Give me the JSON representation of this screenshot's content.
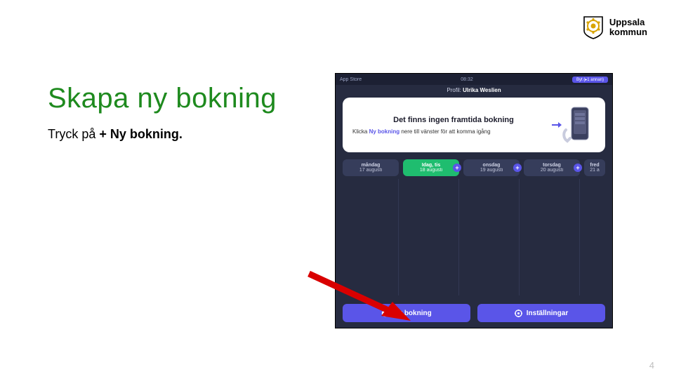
{
  "logo": {
    "line1": "Uppsala",
    "line2": "kommun"
  },
  "title": "Skapa ny bokning",
  "body_prefix": "Tryck på ",
  "body_bold": "+ Ny bokning.",
  "page_number": "4",
  "device": {
    "status_left": "App Store",
    "status_center": "08:32",
    "status_pill": "Byt (▸1 annan)",
    "profile_prefix": "Profil: ",
    "profile_name": "Ulrika Weslien",
    "card_title": "Det finns ingen framtida bokning",
    "card_sub_prefix": "Klicka ",
    "card_sub_link": "Ny bokning",
    "card_sub_suffix": " nere till vänster för att komma igång",
    "days": [
      {
        "dow": "måndag",
        "date": "17 augusti",
        "active": false,
        "plus": false
      },
      {
        "dow": "Idag, tis",
        "date": "18 augusti",
        "active": true,
        "plus": true
      },
      {
        "dow": "onsdag",
        "date": "19 augusti",
        "active": false,
        "plus": true
      },
      {
        "dow": "torsdag",
        "date": "20 augusti",
        "active": false,
        "plus": true
      },
      {
        "dow": "fred",
        "date": "21 a",
        "active": false,
        "plus": false
      }
    ],
    "btn_new": "Ny bokning",
    "btn_settings": "Inställningar"
  },
  "colors": {
    "accent_green": "#1e8a1e",
    "device_bg": "#262b40",
    "purple": "#5a55e8",
    "day_active": "#1fbd6f",
    "arrow_red": "#d90000"
  }
}
